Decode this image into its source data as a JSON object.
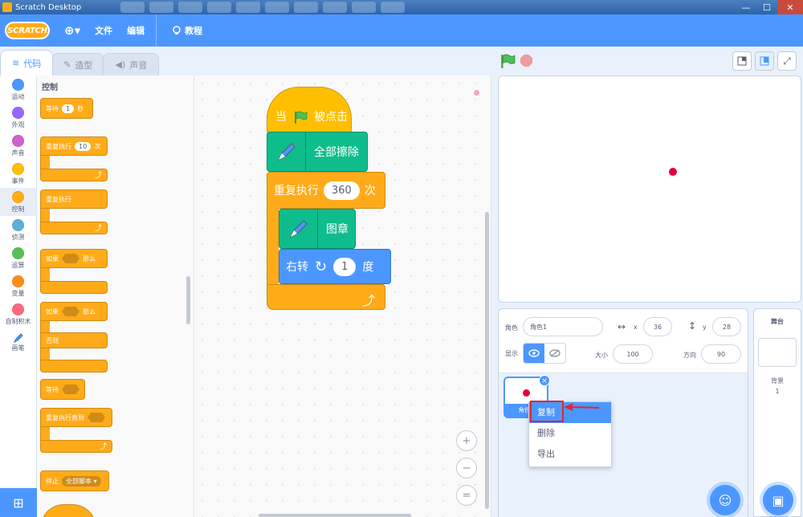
{
  "window": {
    "title": "Scratch Desktop",
    "minimize": "—",
    "maximize": "☐",
    "close": "✕"
  },
  "menubar": {
    "logo": "SCRATCH",
    "globe": "⊕▾",
    "file": "文件",
    "edit": "编辑",
    "tutorials": "教程"
  },
  "tabs": [
    {
      "label": "代码",
      "icon": "code-icon"
    },
    {
      "label": "造型",
      "icon": "brush-icon"
    },
    {
      "label": "声音",
      "icon": "speaker-icon"
    }
  ],
  "categories": [
    {
      "label": "运动",
      "color": "#4c97ff"
    },
    {
      "label": "外观",
      "color": "#9966ff"
    },
    {
      "label": "声音",
      "color": "#cf63cf"
    },
    {
      "label": "事件",
      "color": "#ffbf00"
    },
    {
      "label": "控制",
      "color": "#ffab19"
    },
    {
      "label": "侦测",
      "color": "#5cb1d6"
    },
    {
      "label": "运算",
      "color": "#59c059"
    },
    {
      "label": "变量",
      "color": "#ff8c1a"
    },
    {
      "label": "自制积木",
      "color": "#ff6680"
    },
    {
      "label": "画笔",
      "color": "#0fbd8c"
    }
  ],
  "palette": {
    "title": "控制",
    "wait_label": "等待",
    "wait_value": "1",
    "wait_unit": "秒",
    "repeat_label": "重复执行",
    "repeat_value": "10",
    "repeat_unit": "次",
    "forever_label": "重复执行",
    "if_label": "如果",
    "then_label": "那么",
    "if2_label": "如果",
    "then2_label": "那么",
    "else_label": "否则",
    "wait_until_label": "等待",
    "repeat_until_label": "重复执行直到",
    "stop_label": "停止",
    "stop_option": "全部脚本 ▾"
  },
  "script": {
    "hat_when": "当",
    "hat_clicked": "被点击",
    "clear_label": "全部擦除",
    "repeat_label": "重复执行",
    "repeat_value": "360",
    "repeat_unit": "次",
    "stamp_label": "图章",
    "turn_label": "右转",
    "turn_value": "1",
    "turn_unit": "度",
    "loop_arrow": "⤴"
  },
  "zoom": {
    "in": "+",
    "out": "−",
    "reset": "="
  },
  "sprite_info": {
    "sprite_label": "角色",
    "sprite_name": "角色1",
    "x_label": "x",
    "x_value": "36",
    "y_label": "y",
    "y_value": "28",
    "show_label": "显示",
    "size_label": "大小",
    "size_value": "100",
    "direction_label": "方向",
    "direction_value": "90"
  },
  "sprite_thumb": {
    "name": "角色1"
  },
  "context_menu": {
    "duplicate": "复制",
    "delete": "删除",
    "export": "导出"
  },
  "stage_selector": {
    "title": "舞台",
    "backdrop_label": "背景",
    "backdrop_count": "1"
  },
  "colors": {
    "accent": "#4c97ff",
    "control": "#ffab19",
    "events": "#ffbf00",
    "pen": "#0fbd8c",
    "sprite": "#e3003a"
  }
}
